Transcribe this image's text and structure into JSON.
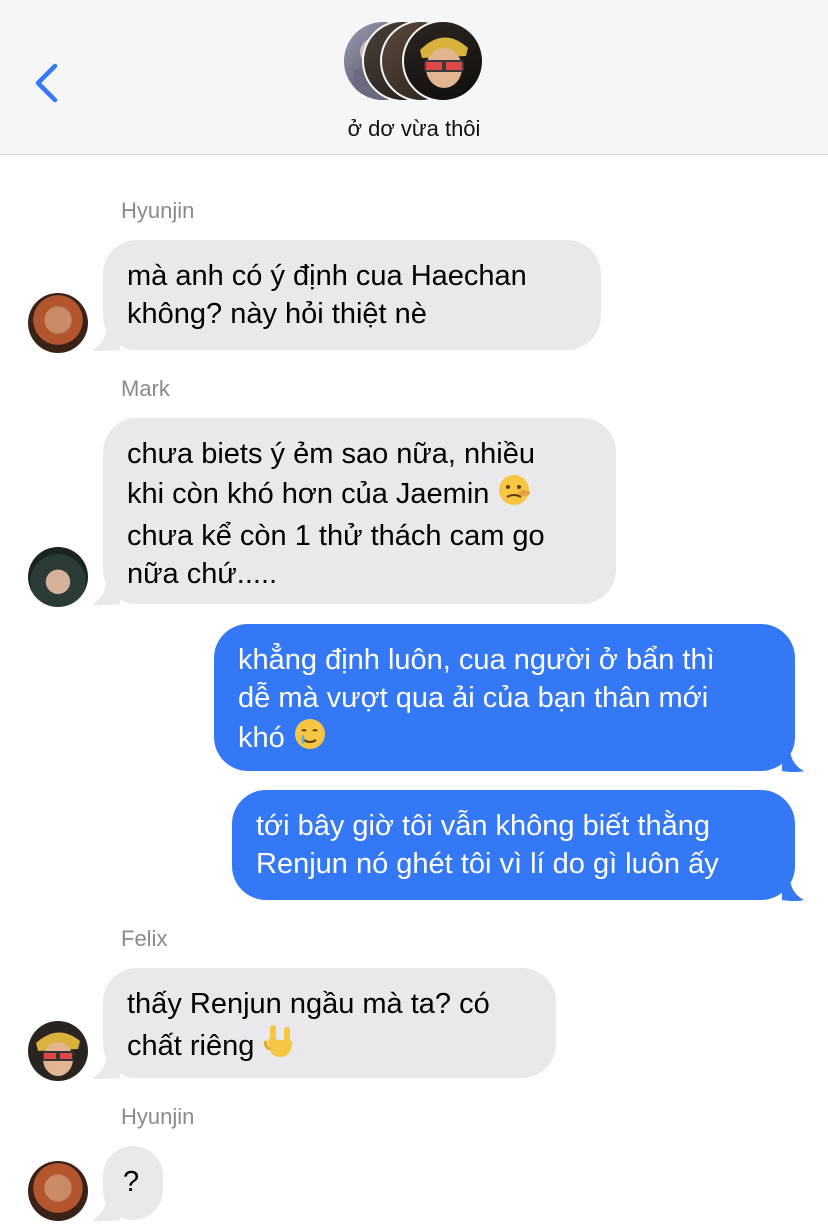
{
  "header": {
    "group_name": "ở dơ vừa thôi",
    "back_icon": "chevron-left-icon",
    "accent": "#3478f6"
  },
  "messages": [
    {
      "sender": "Hyunjin",
      "lines": [
        "mà anh có ý định cua Haechan",
        "không? này hỏi thiệt nè"
      ],
      "direction": "incoming"
    },
    {
      "sender": "Mark",
      "lines": [
        "chưa biets ý ẻm sao nữa, nhiều",
        "khi còn khó hơn của Jaemin",
        "chưa kể còn 1 thử thách cam go",
        "nữa chứ....."
      ],
      "emoji": "lying-face-emoji",
      "direction": "incoming"
    },
    {
      "lines": [
        "khẳng định luôn, cua người ở bẩn thì",
        "dễ mà vượt qua ải của bạn thân mới",
        "khó"
      ],
      "emoji": "crying-smile-emoji",
      "direction": "outgoing"
    },
    {
      "lines": [
        "tới bây giờ tôi vẫn không biết thằng",
        "Renjun nó ghét tôi vì lí do gì luôn ấy"
      ],
      "direction": "outgoing"
    },
    {
      "sender": "Felix",
      "lines": [
        "thấy Renjun ngầu mà ta? có",
        "chất riêng"
      ],
      "emoji": "sign-of-horns-emoji",
      "direction": "incoming"
    },
    {
      "sender": "Hyunjin",
      "lines": [
        "?"
      ],
      "direction": "incoming"
    }
  ],
  "colors": {
    "incoming_bubble": "#e9e9eb",
    "outgoing_bubble": "#3478f6",
    "sender_label": "#8a8a8e",
    "header_bg": "#f6f6f6"
  }
}
